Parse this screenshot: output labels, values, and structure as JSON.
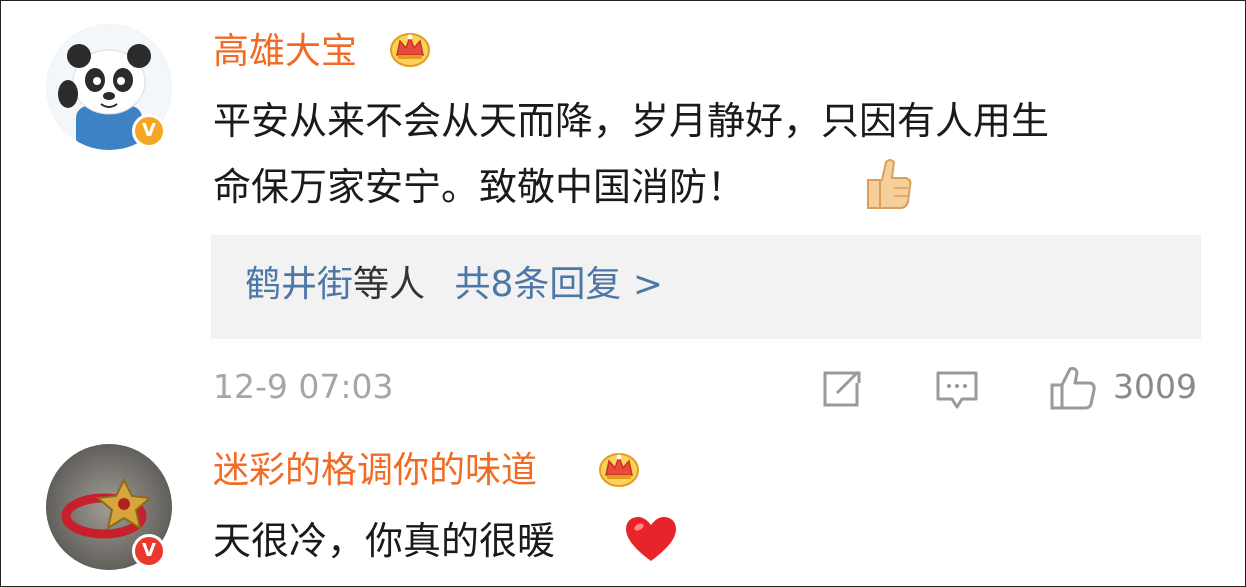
{
  "comments": [
    {
      "username": "高雄大宝",
      "text_line1": "平安从来不会从天而降，岁月静好，只因有人用生",
      "text_line2": "命保万家安宁。致敬中国消防！",
      "verified_badge": "V",
      "badge_color": "#f5a623",
      "reply_preview": {
        "users": "鹤井街",
        "suffix": "等人",
        "count_link": "共8条回复 >"
      },
      "time": "12-9 07:03",
      "likes": "3009"
    },
    {
      "username": "迷彩的格调你的味道",
      "text": "天很冷，你真的很暖",
      "verified_badge": "V",
      "badge_color": "#e8392c"
    }
  ],
  "colors": {
    "username": "#f26b25",
    "link_blue": "#4d77a7",
    "reply_box_bg": "#f2f2f2"
  },
  "icons": [
    "vip-crown-icon",
    "thumbs-up-emoji-icon",
    "repost-icon",
    "comment-icon",
    "like-icon",
    "red-heart-emoji-icon"
  ]
}
